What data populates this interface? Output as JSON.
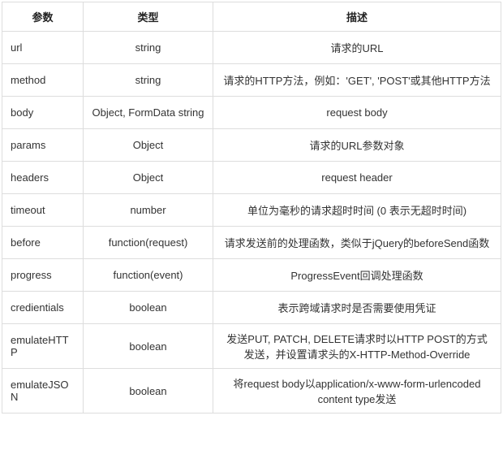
{
  "headers": {
    "param": "参数",
    "type": "类型",
    "desc": "描述"
  },
  "rows": [
    {
      "param": "url",
      "type": "string",
      "desc": "请求的URL"
    },
    {
      "param": "method",
      "type": "string",
      "desc": "请求的HTTP方法，例如：'GET', 'POST'或其他HTTP方法"
    },
    {
      "param": "body",
      "type": "Object, FormData string",
      "desc": "request body"
    },
    {
      "param": "params",
      "type": "Object",
      "desc": "请求的URL参数对象"
    },
    {
      "param": "headers",
      "type": "Object",
      "desc": "request header"
    },
    {
      "param": "timeout",
      "type": "number",
      "desc": "单位为毫秒的请求超时时间 (0 表示无超时时间)"
    },
    {
      "param": "before",
      "type": "function(request)",
      "desc": "请求发送前的处理函数，类似于jQuery的beforeSend函数"
    },
    {
      "param": "progress",
      "type": "function(event)",
      "desc": "ProgressEvent回调处理函数"
    },
    {
      "param": "credientials",
      "type": "boolean",
      "desc": "表示跨域请求时是否需要使用凭证"
    },
    {
      "param": "emulateHTTP",
      "type": "boolean",
      "desc": "发送PUT, PATCH, DELETE请求时以HTTP POST的方式发送，并设置请求头的X-HTTP-Method-Override"
    },
    {
      "param": "emulateJSON",
      "type": "boolean",
      "desc": "将request body以application/x-www-form-urlencoded content type发送"
    }
  ]
}
